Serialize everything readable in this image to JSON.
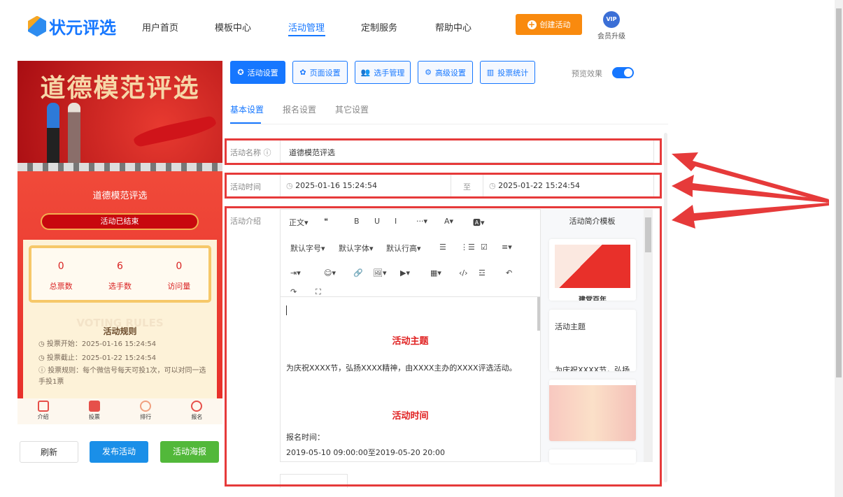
{
  "header": {
    "logo": "状元评选",
    "nav": [
      "用户首页",
      "模板中心",
      "活动管理",
      "定制服务",
      "帮助中心"
    ],
    "active_nav": "活动管理",
    "create_label": "创建活动",
    "vip_badge": "VIP",
    "vip_label": "会员升级"
  },
  "preview": {
    "banner_title": "道德模范评选",
    "title": "道德模范评选",
    "status": "活动已结束",
    "stats": [
      {
        "value": "0",
        "label": "总票数"
      },
      {
        "value": "6",
        "label": "选手数"
      },
      {
        "value": "0",
        "label": "访问量"
      }
    ],
    "rules_bg": "VOTING RULES",
    "rules_title": "活动规则",
    "rules": [
      "投票开始：2025-01-16 15:24:54",
      "投票截止：2025-01-22 15:24:54",
      "投票规则：每个微信号每天可投1次，可以对同一选手投1票"
    ],
    "bottom_nav": [
      "介绍",
      "投票",
      "排行",
      "报名"
    ]
  },
  "actions": {
    "refresh": "刷新",
    "publish": "发布活动",
    "poster": "活动海报"
  },
  "toolbar": {
    "tabs": [
      "活动设置",
      "页面设置",
      "选手管理",
      "高级设置",
      "投票统计"
    ],
    "preview_label": "预览效果",
    "preview_on": true
  },
  "subtabs": [
    "基本设置",
    "报名设置",
    "其它设置"
  ],
  "form": {
    "name_label": "活动名称",
    "name_value": "道德模范评选",
    "time_label": "活动时间",
    "start": "2025-01-16 15:24:54",
    "to": "至",
    "end": "2025-01-22 15:24:54",
    "intro_label": "活动介绍"
  },
  "editor": {
    "row1": [
      "正文▾",
      "❝",
      "B",
      "U",
      "I",
      "···▾",
      "A▾",
      "🅰▾"
    ],
    "row2": [
      "默认字号▾",
      "默认字体▾",
      "默认行高▾",
      "☰",
      "⋮☰",
      "☑",
      "≡▾"
    ],
    "row3": [
      "⇥▾",
      "☺▾",
      "🔗",
      "🖼▾",
      "▶▾",
      "▦▾",
      "‹/›",
      "☲",
      "↶"
    ],
    "row4": [
      "↷",
      "⛶"
    ],
    "content": {
      "h1": "活动主题",
      "p1": "为庆祝XXXX节，弘扬XXXX精神，由XXXX主办的XXXX评选活动。",
      "h2": "活动时间",
      "p2": "报名时间：",
      "p3": "2019-05-10 09:00:00至2019-05-20 20:00"
    }
  },
  "templates": {
    "title": "活动简介模板",
    "items": [
      "建党百年",
      "活动主题",
      "为庆祝XXXX节，弘扬"
    ]
  },
  "colors": {
    "primary": "#1677ff",
    "orange": "#f98a0e",
    "green": "#52b83a",
    "highlight": "#e63a3a"
  }
}
